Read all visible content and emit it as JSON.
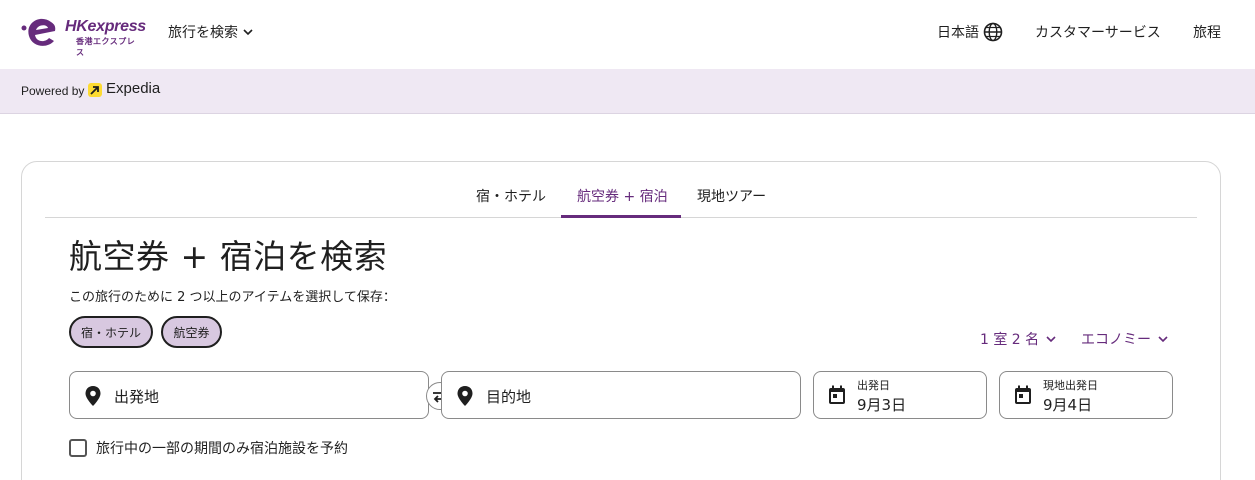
{
  "header": {
    "logo_text": "HKexpress",
    "logo_subtext": "香港エクスプレス",
    "search_menu_label": "旅行を検索",
    "language_label": "日本語",
    "customer_service_label": "カスタマーサービス",
    "trips_label": "旅程"
  },
  "powered_bar": {
    "label": "Powered by",
    "brand": "Expedia"
  },
  "tabs": [
    {
      "label": "宿・ホテル"
    },
    {
      "label": "航空券 + 宿泊"
    },
    {
      "label": "現地ツアー"
    }
  ],
  "active_tab": "航空券 + 宿泊",
  "main": {
    "title": "航空券 + 宿泊を検索",
    "subtitle": "この旅行のために 2 つ以上のアイテムを選択して保存：",
    "chips": [
      {
        "label": "宿・ホテル",
        "selected": true
      },
      {
        "label": "航空券",
        "selected": true
      }
    ],
    "travelers_label": "1 室 2 名",
    "cabin_label": "エコノミー",
    "origin_placeholder": "出発地",
    "destination_placeholder": "目的地",
    "depart": {
      "label": "出発日",
      "value": "9月3日"
    },
    "return": {
      "label": "現地出発日",
      "value": "9月4日"
    },
    "partial_stay_label": "旅行中の一部の期間のみ宿泊施設を予約"
  },
  "colors": {
    "brand_purple": "#662b7c",
    "powered_bg": "#efe8f3",
    "chip_bg": "#d8c8e0",
    "expedia_yellow": "#fddb32"
  }
}
